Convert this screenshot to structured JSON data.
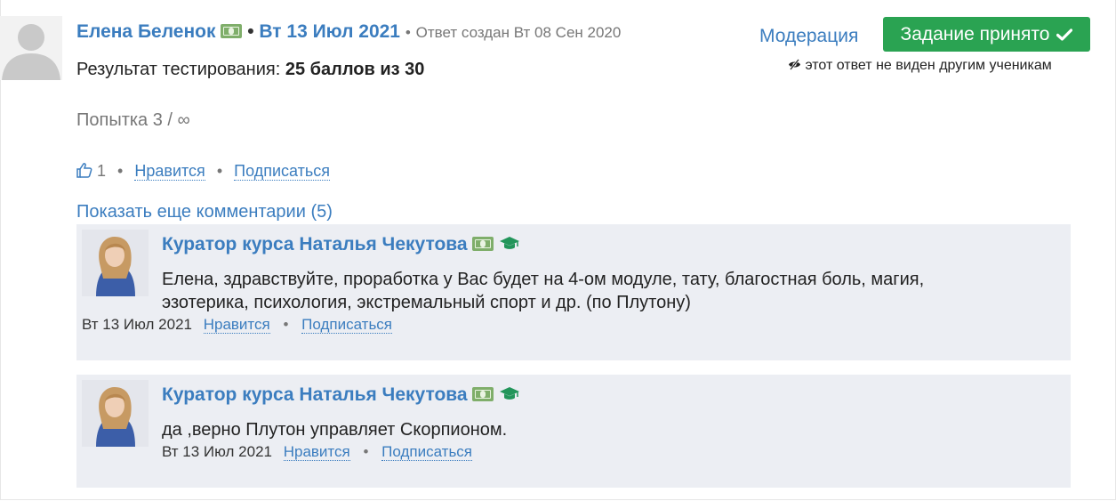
{
  "answer": {
    "author": "Елена Беленок",
    "date": "Вт 13 Июл 2021",
    "created_label": "Ответ создан Вт 08 Сен 2020",
    "result_label": "Результат тестирования:",
    "result_value": "25 баллов из 30",
    "attempt": "Попытка 3 / ∞",
    "likes_count": "1",
    "like_label": "Нравится",
    "subscribe_label": "Подписаться",
    "show_more": "Показать еще комментарии (5)"
  },
  "actions": {
    "moderation": "Модерация",
    "accepted": "Задание принято",
    "hidden_note": "этот ответ не виден другим ученикам"
  },
  "comments": [
    {
      "author": "Куратор курса Наталья Чекутова",
      "text_line1": "Елена, здравствуйте, проработка у Вас будет на 4-ом модуле, тату, благостная боль, магия,",
      "text_line2": "эзотерика, психология, экстремальный спорт и др. (по Плутону)",
      "date": "Вт 13 Июл 2021",
      "like_label": "Нравится",
      "subscribe_label": "Подписаться"
    },
    {
      "author": "Куратор курса Наталья Чекутова",
      "text_line1": "да ,верно Плутон управляет Скорпионом.",
      "date": "Вт 13 Июл 2021",
      "like_label": "Нравится",
      "subscribe_label": "Подписаться"
    }
  ],
  "colors": {
    "accent": "#3b7dbf",
    "success": "#2aa352",
    "comment_bg": "#eceef3"
  }
}
